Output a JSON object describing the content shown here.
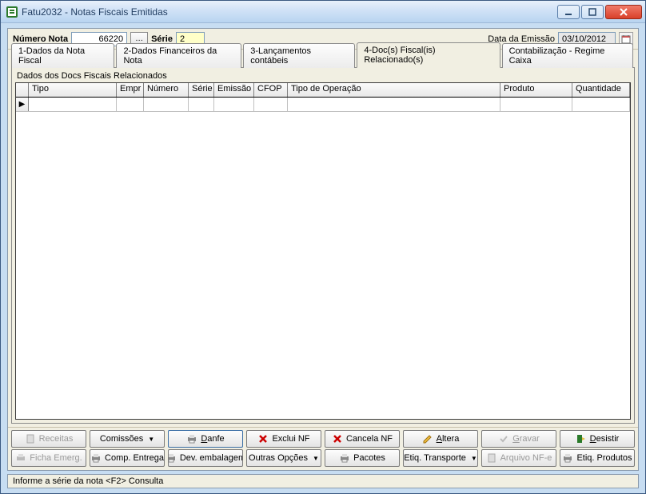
{
  "window": {
    "title": "Fatu2032 - Notas Fiscais Emitidas"
  },
  "fields": {
    "numero_label": "Número Nota",
    "numero_value": "66220",
    "serie_label": "Série",
    "serie_value": "2",
    "data_label": "Data da Emissão",
    "data_value": "03/10/2012"
  },
  "tabs": {
    "t1": "1-Dados da Nota Fiscal",
    "t2": "2-Dados Financeiros da Nota",
    "t3": "3-Lançamentos contábeis",
    "t4": "4-Doc(s) Fiscal(is) Relacionado(s)",
    "t5": "Contabilização - Regime Caixa"
  },
  "group_title": "Dados dos Docs Fiscais Relacionados",
  "cols": {
    "tipo": "Tipo",
    "empr": "Empr",
    "numero": "Número",
    "serie": "Série",
    "emissao": "Emissão",
    "cfop": "CFOP",
    "tipo_op": "Tipo de Operação",
    "produto": "Produto",
    "qtd": "Quantidade"
  },
  "buttons": {
    "receitas": "Receitas",
    "comissoes": "Comissões",
    "danfe": "Danfe",
    "exclui": "Exclui NF",
    "cancela": "Cancela NF",
    "altera": "Altera",
    "gravar": "Gravar",
    "desistir": "Desistir",
    "ficha": "Ficha Emerg.",
    "comp": "Comp. Entrega",
    "dev": "Dev. embalagem",
    "outras": "Outras Opções",
    "pacotes": "Pacotes",
    "etiqt": "Etiq. Transporte",
    "arquivo": "Arquivo NF-e",
    "etiqp": "Etiq. Produtos"
  },
  "status": "Informe a série da nota <F2> Consulta"
}
